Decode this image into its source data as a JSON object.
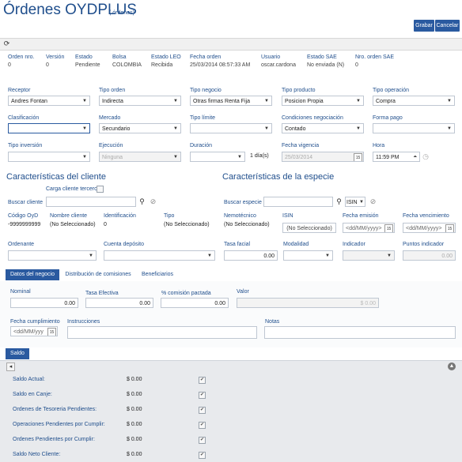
{
  "header": {
    "title": "Órdenes OYDPLUS",
    "subtitle": "( órdenes)",
    "save_label": "Grabar",
    "cancel_label": "Cancelar"
  },
  "summary": [
    {
      "label": "Orden nro.",
      "value": "0"
    },
    {
      "label": "Versión",
      "value": "0"
    },
    {
      "label": "Estado",
      "value": "Pendiente"
    },
    {
      "label": "Bolsa",
      "value": "COLOMBIA"
    },
    {
      "label": "Estado LEO",
      "value": "Recibida"
    },
    {
      "label": "Fecha orden",
      "value": "25/03/2014 08:57:33 AM"
    },
    {
      "label": "Usuario",
      "value": "oscar.cardona"
    },
    {
      "label": "Estado SAE",
      "value": "No enviada (N)"
    },
    {
      "label": "Nro. orden SAE",
      "value": "0"
    }
  ],
  "form": {
    "receptor": {
      "label": "Receptor",
      "value": "Andres Fontan"
    },
    "tipo_orden": {
      "label": "Tipo orden",
      "value": "Indirecta"
    },
    "tipo_negocio": {
      "label": "Tipo negocio",
      "value": "Otras firmas Renta Fija"
    },
    "tipo_producto": {
      "label": "Tipo producto",
      "value": "Posicion Propia"
    },
    "tipo_operacion": {
      "label": "Tipo operación",
      "value": "Compra"
    },
    "clasificacion": {
      "label": "Clasificación",
      "value": ""
    },
    "mercado": {
      "label": "Mercado",
      "value": "Secundario"
    },
    "tipo_limite": {
      "label": "Tipo límite",
      "value": ""
    },
    "condiciones": {
      "label": "Condiciones negociación",
      "value": "Contado"
    },
    "forma_pago": {
      "label": "Forma pago",
      "value": ""
    },
    "tipo_inversion": {
      "label": "Tipo inversión",
      "value": ""
    },
    "ejecucion": {
      "label": "Ejecución",
      "value": "Ninguna"
    },
    "duracion": {
      "label": "Duración",
      "value": "",
      "suffix": "1 día(s)"
    },
    "fecha_vigencia": {
      "label": "Fecha vigencia",
      "value": "25/03/2014",
      "cal": "15"
    },
    "hora": {
      "label": "Hora",
      "value": "11:59 PM"
    }
  },
  "cliente": {
    "heading": "Características del cliente",
    "carga_label": "Carga cliente tercero",
    "buscar_label": "Buscar cliente",
    "codigo_label": "Código OyD",
    "codigo_value": "-9999999999",
    "nombre_label": "Nombre cliente",
    "nombre_value": "(No Seleccionado)",
    "ident_label": "Identificación",
    "ident_value": "0",
    "tipo_label": "Tipo",
    "tipo_value": "(No Seleccionado)",
    "ordenante_label": "Ordenante",
    "cuenta_label": "Cuenta depósito"
  },
  "especie": {
    "heading": "Características de la especie",
    "buscar_label": "Buscar especie",
    "isin_select": "ISIN",
    "nemo_label": "Nemotécnico",
    "nemo_value": "(No Seleccionado)",
    "isin_label": "ISIN",
    "isin_value": "(No Seleccionado)",
    "emision_label": "Fecha emisión",
    "emision_placeholder": "<dd/MM/yyyy>",
    "venc_label": "Fecha vencimiento",
    "venc_placeholder": "<dd/MM/yyyy>",
    "cal": "15",
    "tasa_label": "Tasa facial",
    "tasa_value": "0.00",
    "modalidad_label": "Modalidad",
    "indicador_label": "Indicador",
    "puntos_label": "Puntos indicador",
    "puntos_value": "0.00"
  },
  "tabs": [
    "Datos del negocio",
    "Distribución de comisiones",
    "Beneficiarios"
  ],
  "negocio": {
    "nominal_label": "Nominal",
    "nominal_value": "0.00",
    "tasa_label": "Tasa Efectiva",
    "tasa_value": "0.00",
    "comision_label": "% comisión pactada",
    "comision_value": "0.00",
    "valor_label": "Valor",
    "valor_value": "$ 0.00",
    "fecha_label": "Fecha cumplimiento",
    "fecha_placeholder": "<dd/MM/yyy",
    "instr_label": "Instrucciones",
    "notas_label": "Notas"
  },
  "saldo": {
    "tab": "Saldo",
    "rows": [
      {
        "label": "Saldo Actual:",
        "value": "$ 0.00"
      },
      {
        "label": "Saldo en Canje:",
        "value": "$ 0.00"
      },
      {
        "label": "Ordenes de Tesoreria Pendientes:",
        "value": "$ 0.00"
      },
      {
        "label": "Operaciones Pendientes por Cumplir:",
        "value": "$ 0.00"
      },
      {
        "label": "Ordenes Pendientes por Cumplir:",
        "value": "$ 0.00"
      },
      {
        "label": "Saldo Neto Cliente:",
        "value": "$ 0.00"
      }
    ]
  },
  "icons": {
    "refresh": "refresh-icon",
    "search": "search-icon",
    "clear": "clear-icon"
  },
  "colors": {
    "accent": "#2a5aa0",
    "title": "#1f4e8c"
  }
}
